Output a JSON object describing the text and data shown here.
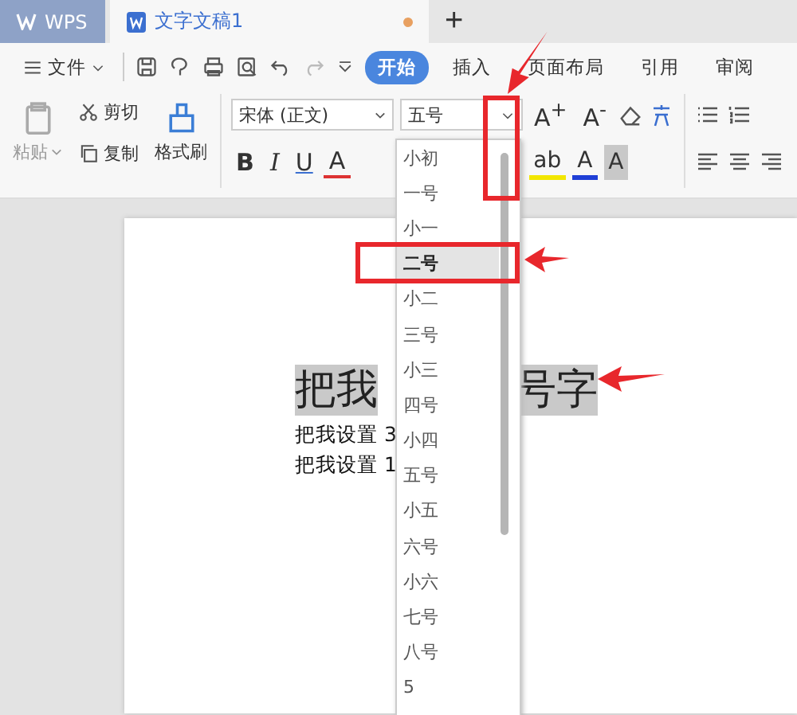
{
  "tabs": [
    {
      "kind": "home",
      "label": "WPS",
      "selected": false,
      "unsaved": false
    },
    {
      "kind": "document",
      "label": "文字文稿1",
      "selected": true,
      "unsaved": true
    }
  ],
  "new_tab": "+",
  "menu": {
    "file": "文件",
    "tabs": [
      {
        "label": "开始",
        "selected": true
      },
      {
        "label": "插入",
        "selected": false
      },
      {
        "label": "页面布局",
        "selected": false
      },
      {
        "label": "引用",
        "selected": false
      },
      {
        "label": "审阅",
        "selected": false
      }
    ]
  },
  "ribbon": {
    "paste": "粘贴",
    "cut": "剪切",
    "copy": "复制",
    "format_painter": "格式刷",
    "font_family": "宋体 (正文)",
    "font_size": "五号",
    "size_buttons": [
      "A$^{+}$",
      "A$^{-}$"
    ],
    "style_buttons": [
      {
        "kind": "bold",
        "label": "B"
      },
      {
        "kind": "italic",
        "label": "I"
      },
      {
        "kind": "underline",
        "label": "U"
      },
      {
        "kind": "strike",
        "label": "A"
      }
    ],
    "color_buttons": [
      {
        "kind": "highlight",
        "label": "ab",
        "color": "#f2e600"
      },
      {
        "kind": "font_color",
        "label": "A",
        "color": "#1f3fd6"
      },
      {
        "kind": "shade",
        "label": "A",
        "color": "#c8c8c8"
      }
    ]
  },
  "document": {
    "heading": [
      "把我",
      "号字"
    ],
    "lines": [
      "把我设置 3",
      "把我设置 1"
    ]
  },
  "size_dropdown": {
    "items": [
      {
        "label": "小初",
        "selected": false
      },
      {
        "label": "一号",
        "selected": false
      },
      {
        "label": "小一",
        "selected": false
      },
      {
        "label": "二号",
        "selected": true
      },
      {
        "label": "小二",
        "selected": false
      },
      {
        "label": "三号",
        "selected": false
      },
      {
        "label": "小三",
        "selected": false
      },
      {
        "label": "四号",
        "selected": false
      },
      {
        "label": "小四",
        "selected": false
      },
      {
        "label": "五号",
        "selected": false
      },
      {
        "label": "小五",
        "selected": false
      },
      {
        "label": "六号",
        "selected": false
      },
      {
        "label": "小六",
        "selected": false
      },
      {
        "label": "七号",
        "selected": false
      },
      {
        "label": "八号",
        "selected": false
      },
      {
        "label": "5",
        "selected": false
      }
    ]
  }
}
